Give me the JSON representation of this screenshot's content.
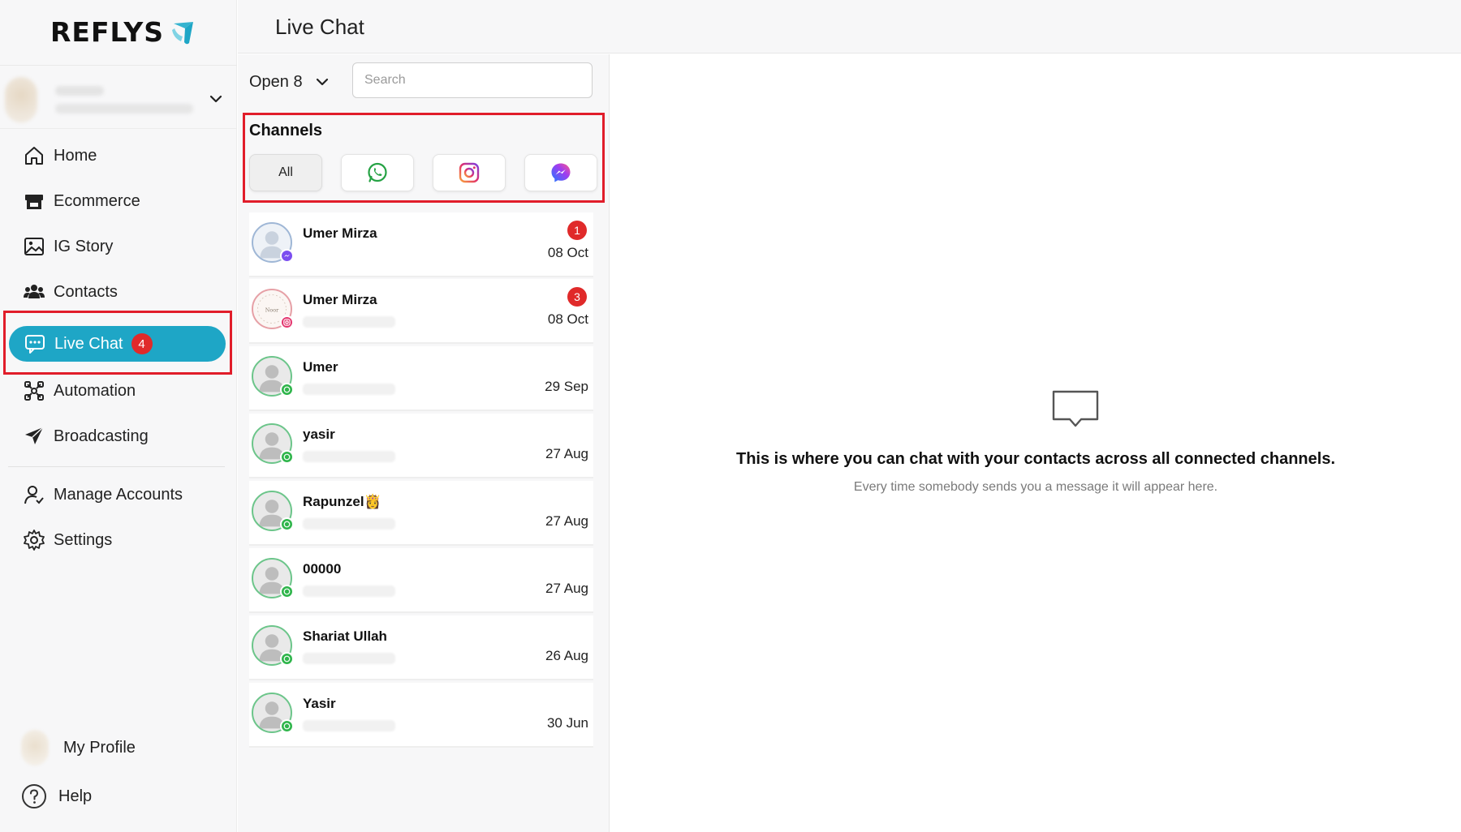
{
  "brand": {
    "name": "REFLYS",
    "accent": "#1ea6c6"
  },
  "sidebar": {
    "items": [
      {
        "label": "Home",
        "icon": "home-icon"
      },
      {
        "label": "Ecommerce",
        "icon": "store-icon"
      },
      {
        "label": "IG Story",
        "icon": "image-icon"
      },
      {
        "label": "Contacts",
        "icon": "contacts-icon"
      },
      {
        "label": "Live Chat",
        "icon": "chat-icon",
        "badge": "4",
        "active": true
      },
      {
        "label": "Automation",
        "icon": "automation-icon"
      },
      {
        "label": "Broadcasting",
        "icon": "send-icon"
      },
      {
        "label": "Manage Accounts",
        "icon": "user-icon"
      },
      {
        "label": "Settings",
        "icon": "gear-icon"
      }
    ],
    "profile_label": "My Profile",
    "help_label": "Help"
  },
  "header": {
    "title": "Live Chat"
  },
  "filter": {
    "status_label": "Open 8"
  },
  "search": {
    "placeholder": "Search"
  },
  "channels": {
    "title": "Channels",
    "buttons": [
      {
        "label": "All",
        "active": true
      },
      {
        "icon": "whatsapp-icon",
        "color": "#25d366"
      },
      {
        "icon": "instagram-icon",
        "color": "#e1306c"
      },
      {
        "icon": "messenger-icon",
        "color": "#7b4ef0"
      }
    ]
  },
  "conversations": [
    {
      "name": "Umer Mirza",
      "date": "08 Oct",
      "unread": "1",
      "channel": "messenger"
    },
    {
      "name": "Umer Mirza",
      "date": "08 Oct",
      "unread": "3",
      "channel": "instagram"
    },
    {
      "name": "Umer",
      "date": "29 Sep",
      "channel": "whatsapp"
    },
    {
      "name": "yasir",
      "date": "27 Aug",
      "channel": "whatsapp"
    },
    {
      "name": "Rapunzel👸",
      "date": "27 Aug",
      "channel": "whatsapp"
    },
    {
      "name": "00000",
      "date": "27 Aug",
      "channel": "whatsapp"
    },
    {
      "name": "Shariat Ullah",
      "date": "26 Aug",
      "channel": "whatsapp"
    },
    {
      "name": "Yasir",
      "date": "30 Jun",
      "channel": "whatsapp"
    }
  ],
  "empty_state": {
    "title": "This is where you can chat with your contacts across all connected channels.",
    "subtitle": "Every time somebody sends you a message it will appear here."
  },
  "colors": {
    "highlight_frame": "#e11d2a",
    "badge": "#e02a2a",
    "whatsapp": "#2fb54b"
  }
}
